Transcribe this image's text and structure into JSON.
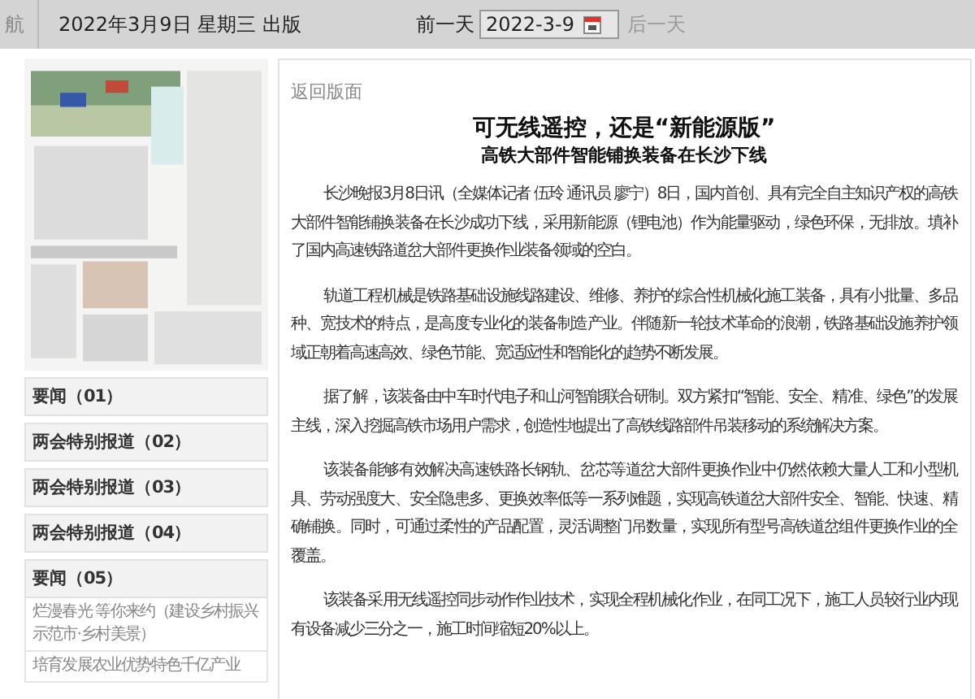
{
  "top_bar": {
    "left_stub": "航",
    "date_label": "2022年3月9日 星期三 出版",
    "prev": {
      "label": "前一天",
      "disabled": false
    },
    "date_field": {
      "value": "2022-3-9"
    },
    "next": {
      "label": "后一天",
      "disabled": true
    }
  },
  "sidebar": {
    "sections": [
      {
        "label": "要闻（01）"
      },
      {
        "label": "两会特别报道（02）"
      },
      {
        "label": "两会特别报道（03）"
      },
      {
        "label": "两会特别报道（04）"
      },
      {
        "label": "要闻（05）",
        "children": [
          {
            "label": "烂漫春光 等你来约（建设乡村振兴示范市·乡村美景）"
          },
          {
            "label": "培育发展农业优势特色千亿产业"
          }
        ]
      }
    ]
  },
  "article": {
    "back_link": "返回版面",
    "title": "可无线遥控，还是“新能源版”",
    "subtitle": "高铁大部件智能铺换装备在长沙下线",
    "paragraphs": [
      "长沙晚报3月8日讯（全媒体记者 伍玲 通讯员 廖宁）8日，国内首创、具有完全自主知识产权的高铁大部件智能铺换装备在长沙成功下线，采用新能源（锂电池）作为能量驱动，绿色环保，无排放。填补了国内高速铁路道岔大部件更换作业装备领域的空白。",
      "轨道工程机械是铁路基础设施线路建设、维修、养护的综合性机械化施工装备，具有小批量、多品种、宽技术的特点，是高度专业化的装备制造产业。伴随新一轮技术革命的浪潮，铁路基础设施养护领域正朝着高速高效、绿色节能、宽适应性和智能化的趋势不断发展。",
      "据了解，该装备由中车时代电子和山河智能联合研制。双方紧扣“智能、安全、精准、绿色”的发展主线，深入挖掘高铁市场用户需求，创造性地提出了高铁线路部件吊装移动的系统解决方案。",
      "该装备能够有效解决高速铁路长钢轨、岔芯等道岔大部件更换作业中仍然依赖大量人工和小型机具、劳动强度大、安全隐患多、更换效率低等一系列难题，实现高铁道岔大部件安全、智能、快速、精确铺换。同时，可通过柔性的产品配置，灵活调整门吊数量，实现所有型号高铁道岔组件更换作业的全覆盖。",
      "该装备采用无线遥控同步动作作业技术，实现全程机械化作业，在同工况下，施工人员较行业内现有设备减少三分之一，施工时间缩短20%以上。"
    ]
  }
}
